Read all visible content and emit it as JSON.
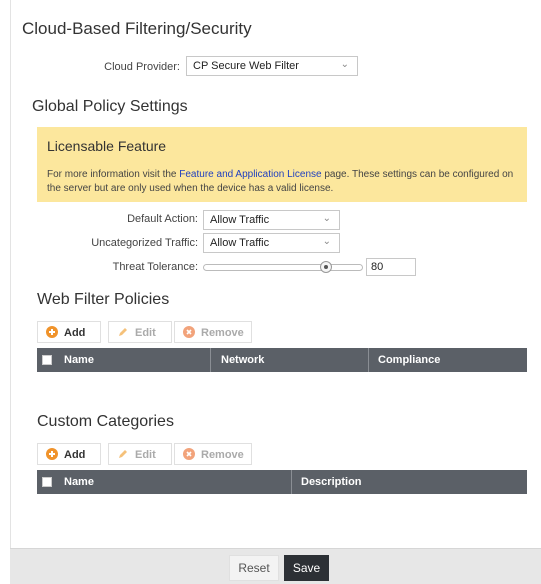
{
  "page": {
    "title": "Cloud-Based Filtering/Security"
  },
  "cloud_provider": {
    "label": "Cloud Provider:",
    "value": "CP Secure Web Filter"
  },
  "global": {
    "title": "Global Policy Settings"
  },
  "notice": {
    "title": "Licensable Feature",
    "text_before": "For more information visit the ",
    "link": "Feature and Application License",
    "text_after": " page. These settings can be configured on the server but are only used when the device has a valid license."
  },
  "settings": {
    "default_action_label": "Default Action:",
    "default_action_value": "Allow Traffic",
    "uncategorized_label": "Uncategorized Traffic:",
    "uncategorized_value": "Allow Traffic",
    "threat_label": "Threat Tolerance:",
    "threat_value": "80",
    "threat_fraction": 0.8
  },
  "web_filter": {
    "title": "Web Filter Policies",
    "toolbar": {
      "add": "Add",
      "edit": "Edit",
      "remove": "Remove"
    },
    "columns": [
      "Name",
      "Network",
      "Compliance"
    ]
  },
  "custom": {
    "title": "Custom Categories",
    "toolbar": {
      "add": "Add",
      "edit": "Edit",
      "remove": "Remove"
    },
    "columns": [
      "Name",
      "Description"
    ]
  },
  "footer": {
    "reset": "Reset",
    "save": "Save"
  },
  "colors": {
    "accent_orange": "#f0932b",
    "notice_bg": "#fce79d",
    "header_bg": "#5b6067",
    "save_bg": "#2c3035"
  }
}
